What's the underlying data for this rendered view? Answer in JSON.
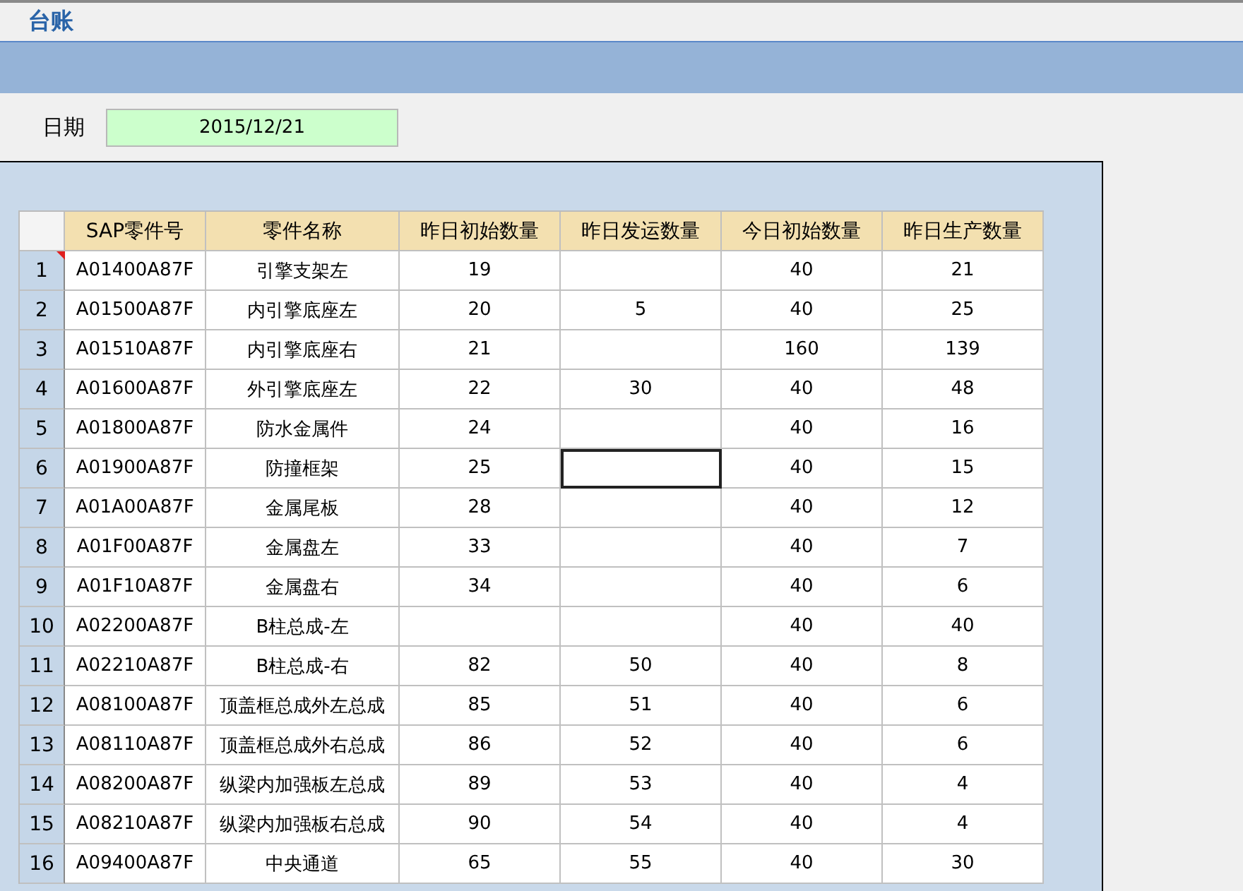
{
  "window": {
    "title": "台账"
  },
  "date": {
    "label": "日期",
    "value": "2015/12/21"
  },
  "table": {
    "columns": [
      "SAP零件号",
      "零件名称",
      "昨日初始数量",
      "昨日发运数量",
      "今日初始数量",
      "昨日生产数量"
    ],
    "rows": [
      {
        "number": "1",
        "comment_mark": true,
        "cells": [
          {
            "text": "A01400A87F",
            "selected": false
          },
          {
            "text": "引擎支架左",
            "selected": false
          },
          {
            "text": "19",
            "selected": false
          },
          {
            "selected": false
          },
          {
            "text": "40",
            "selected": false
          },
          {
            "text": "21",
            "selected": false
          }
        ]
      },
      {
        "number": "2",
        "comment_mark": false,
        "cells": [
          {
            "text": "A01500A87F",
            "selected": false
          },
          {
            "text": "内引擎底座左",
            "selected": false
          },
          {
            "text": "20",
            "selected": false
          },
          {
            "text": "5",
            "selected": false
          },
          {
            "text": "40",
            "selected": false
          },
          {
            "text": "25",
            "selected": false
          }
        ]
      },
      {
        "number": "3",
        "comment_mark": false,
        "cells": [
          {
            "text": "A01510A87F",
            "selected": false
          },
          {
            "text": "内引擎底座右",
            "selected": false
          },
          {
            "text": "21",
            "selected": false
          },
          {
            "selected": false
          },
          {
            "text": "160",
            "selected": false
          },
          {
            "text": "139",
            "selected": false
          }
        ]
      },
      {
        "number": "4",
        "comment_mark": false,
        "cells": [
          {
            "text": "A01600A87F",
            "selected": false
          },
          {
            "text": "外引擎底座左",
            "selected": false
          },
          {
            "text": "22",
            "selected": false
          },
          {
            "text": "30",
            "selected": false
          },
          {
            "text": "40",
            "selected": false
          },
          {
            "text": "48",
            "selected": false
          }
        ]
      },
      {
        "number": "5",
        "comment_mark": false,
        "cells": [
          {
            "text": "A01800A87F",
            "selected": false
          },
          {
            "text": "防水金属件",
            "selected": false
          },
          {
            "text": "24",
            "selected": false
          },
          {
            "selected": false
          },
          {
            "text": "40",
            "selected": false
          },
          {
            "text": "16",
            "selected": false
          }
        ]
      },
      {
        "number": "6",
        "comment_mark": false,
        "cells": [
          {
            "text": "A01900A87F",
            "selected": false
          },
          {
            "text": "防撞框架",
            "selected": false
          },
          {
            "text": "25",
            "selected": false
          },
          {
            "selected": true
          },
          {
            "text": "40",
            "selected": false
          },
          {
            "text": "15",
            "selected": false
          }
        ]
      },
      {
        "number": "7",
        "comment_mark": false,
        "cells": [
          {
            "text": "A01A00A87F",
            "selected": false
          },
          {
            "text": "金属尾板",
            "selected": false
          },
          {
            "text": "28",
            "selected": false
          },
          {
            "selected": false
          },
          {
            "text": "40",
            "selected": false
          },
          {
            "text": "12",
            "selected": false
          }
        ]
      },
      {
        "number": "8",
        "comment_mark": false,
        "cells": [
          {
            "text": "A01F00A87F",
            "selected": false
          },
          {
            "text": "金属盘左",
            "selected": false
          },
          {
            "text": "33",
            "selected": false
          },
          {
            "selected": false
          },
          {
            "text": "40",
            "selected": false
          },
          {
            "text": "7",
            "selected": false
          }
        ]
      },
      {
        "number": "9",
        "comment_mark": false,
        "cells": [
          {
            "text": "A01F10A87F",
            "selected": false
          },
          {
            "text": "金属盘右",
            "selected": false
          },
          {
            "text": "34",
            "selected": false
          },
          {
            "selected": false
          },
          {
            "text": "40",
            "selected": false
          },
          {
            "text": "6",
            "selected": false
          }
        ]
      },
      {
        "number": "10",
        "comment_mark": false,
        "cells": [
          {
            "text": "A02200A87F",
            "selected": false
          },
          {
            "text": "B柱总成-左",
            "selected": false
          },
          {
            "selected": false
          },
          {
            "selected": false
          },
          {
            "text": "40",
            "selected": false
          },
          {
            "text": "40",
            "selected": false
          }
        ]
      },
      {
        "number": "11",
        "comment_mark": false,
        "cells": [
          {
            "text": "A02210A87F",
            "selected": false
          },
          {
            "text": "B柱总成-右",
            "selected": false
          },
          {
            "text": "82",
            "selected": false
          },
          {
            "text": "50",
            "selected": false
          },
          {
            "text": "40",
            "selected": false
          },
          {
            "text": "8",
            "selected": false
          }
        ]
      },
      {
        "number": "12",
        "comment_mark": false,
        "cells": [
          {
            "text": "A08100A87F",
            "selected": false
          },
          {
            "text": "顶盖框总成外左总成",
            "selected": false
          },
          {
            "text": "85",
            "selected": false
          },
          {
            "text": "51",
            "selected": false
          },
          {
            "text": "40",
            "selected": false
          },
          {
            "text": "6",
            "selected": false
          }
        ]
      },
      {
        "number": "13",
        "comment_mark": false,
        "cells": [
          {
            "text": "A08110A87F",
            "selected": false
          },
          {
            "text": "顶盖框总成外右总成",
            "selected": false
          },
          {
            "text": "86",
            "selected": false
          },
          {
            "text": "52",
            "selected": false
          },
          {
            "text": "40",
            "selected": false
          },
          {
            "text": "6",
            "selected": false
          }
        ]
      },
      {
        "number": "14",
        "comment_mark": false,
        "cells": [
          {
            "text": "A08200A87F",
            "selected": false
          },
          {
            "text": "纵梁内加强板左总成",
            "selected": false
          },
          {
            "text": "89",
            "selected": false
          },
          {
            "text": "53",
            "selected": false
          },
          {
            "text": "40",
            "selected": false
          },
          {
            "text": "4",
            "selected": false
          }
        ]
      },
      {
        "number": "15",
        "comment_mark": false,
        "cells": [
          {
            "text": "A08210A87F",
            "selected": false
          },
          {
            "text": "纵梁内加强板右总成",
            "selected": false
          },
          {
            "text": "90",
            "selected": false
          },
          {
            "text": "54",
            "selected": false
          },
          {
            "text": "40",
            "selected": false
          },
          {
            "text": "4",
            "selected": false
          }
        ]
      },
      {
        "number": "16",
        "comment_mark": false,
        "cells": [
          {
            "text": "A09400A87F",
            "selected": false
          },
          {
            "text": "中央通道",
            "selected": false
          },
          {
            "text": "65",
            "selected": false
          },
          {
            "text": "55",
            "selected": false
          },
          {
            "text": "40",
            "selected": false
          },
          {
            "text": "30",
            "selected": false
          }
        ]
      }
    ]
  }
}
